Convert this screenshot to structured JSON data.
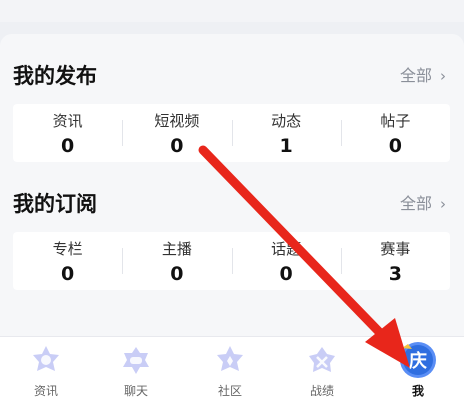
{
  "sections": [
    {
      "title": "我的发布",
      "all_label": "全部",
      "items": [
        {
          "label": "资讯",
          "value": "0"
        },
        {
          "label": "短视频",
          "value": "0"
        },
        {
          "label": "动态",
          "value": "1"
        },
        {
          "label": "帖子",
          "value": "0"
        }
      ]
    },
    {
      "title": "我的订阅",
      "all_label": "全部",
      "items": [
        {
          "label": "专栏",
          "value": "0"
        },
        {
          "label": "主播",
          "value": "0"
        },
        {
          "label": "话题",
          "value": "0"
        },
        {
          "label": "赛事",
          "value": "3"
        }
      ]
    }
  ],
  "tabbar": [
    {
      "label": "资讯",
      "icon": "news-icon"
    },
    {
      "label": "聊天",
      "icon": "chat-icon"
    },
    {
      "label": "社区",
      "icon": "community-icon"
    },
    {
      "label": "战绩",
      "icon": "record-icon"
    },
    {
      "label": "我",
      "icon": "profile-avatar-icon",
      "active": true
    }
  ],
  "avatar_glyph": "庆",
  "colors": {
    "accent_blue": "#5a8ef5",
    "tab_icon_lavender": "#c9cdf6",
    "annotation_red": "#e8261b"
  }
}
